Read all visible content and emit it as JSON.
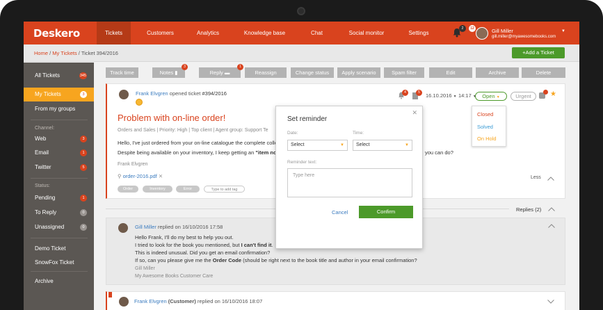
{
  "app": {
    "logo": "Deskero"
  },
  "nav": {
    "items": [
      "Tickets",
      "Customers",
      "Analytics",
      "Knowledge base",
      "Chat",
      "Social monitor",
      "Settings"
    ],
    "bell_count": "2",
    "user_badge": "12",
    "user_name": "Gill Miller",
    "user_email": "gill.miller@myawesomebooks.com"
  },
  "breadcrumb": {
    "home": "Home",
    "sep1": " / ",
    "my_tickets": "My Tickets",
    "current": " / Ticket 394/2016"
  },
  "add_ticket_label": "+Add a Ticket",
  "sidebar": {
    "all_tickets": {
      "label": "All Tickets",
      "count": "345"
    },
    "my_tickets": {
      "label": "My Tickets",
      "count": "3"
    },
    "from_groups": {
      "label": "From my groups"
    },
    "channel_head": "Channel:",
    "web": {
      "label": "Web",
      "count": "3"
    },
    "email": {
      "label": "Email",
      "count": "1"
    },
    "twitter": {
      "label": "Twitter",
      "count": "5"
    },
    "status_head": "Status:",
    "pending": {
      "label": "Pending",
      "count": "1"
    },
    "to_reply": {
      "label": "To Reply",
      "count": "0"
    },
    "unassigned": {
      "label": "Unassigned",
      "count": "0"
    },
    "demo_ticket": {
      "label": "Demo Ticket"
    },
    "snowfox": {
      "label": "SnowFox Ticket"
    },
    "archive": {
      "label": "Archive"
    }
  },
  "toolbar": {
    "track_time": "Track time",
    "notes": "Notes",
    "notes_count": "3",
    "reply": "Reply",
    "reply_count": "1",
    "reassign": "Reassign",
    "change_status": "Change status",
    "apply_scenario": "Apply scenario",
    "spam_filter": "Spam filter",
    "edit": "Edit",
    "archive": "Archive",
    "delete": "Delete"
  },
  "ticket": {
    "opener_name": "Frank Elvgren",
    "opener_text": " opened ticket ",
    "number": "#394/2016",
    "comment_count": "4",
    "notes_count": "5",
    "date": "16.10.2016",
    "time": "14:17",
    "status": "Open",
    "priority_pill": "Urgent",
    "title": "Problem with on-line order!",
    "meta": "Orders and Sales  |  Priority: High  |  Top client  |  Agent group: Support Te",
    "body_line1": "Hello, I've just ordered from your on-line catalogue the complete colle",
    "body_line2_a": "Despite being available on your inventory, I keep getting an ",
    "body_line2_b": "\"item not",
    "body_line2_tail": "you can do?",
    "signature": "Frank Elvgren",
    "attachment": "order-2016.pdf",
    "tags": [
      "Order",
      "Inventory",
      "Error"
    ],
    "add_tag": "Type to add tag",
    "less": "Less"
  },
  "status_menu": {
    "closed": "Closed",
    "solved": "Solved",
    "on_hold": "On Hold"
  },
  "reminder": {
    "title": "Set reminder",
    "date_label": "Date:",
    "time_label": "Time:",
    "date_value": "Select",
    "time_value": "Select",
    "text_label": "Reminder text:",
    "text_placeholder": "Type here",
    "cancel": "Cancel",
    "confirm": "Confirm"
  },
  "replies": {
    "label": "Replies (2)",
    "reply1": {
      "author": "Gill Miller",
      "meta": " replied on 16/10/2016 17:58",
      "line1": "Hello Frank, I'll do my best to help you out.",
      "line2_a": "I tried to look for the book you mentioned, but ",
      "line2_b": "I can't find it",
      "line2_c": ".",
      "line3": "This is indeed unusual. Did you get an email confirmation?",
      "line4_a": "If so, can you please give me the ",
      "line4_b": "Order Code",
      "line4_c": " (should be right next to the book title and author in your email confirmation?",
      "sig1": "Gill Miller",
      "sig2": "My Awesome Books Customer Care"
    },
    "reply2": {
      "author": "Frank Elvgren",
      "role": " (Customer)",
      "meta": " replied on 16/10/2016 18:07"
    }
  },
  "colors": {
    "brand": "#d9431e",
    "accent": "#f7a51f",
    "green": "#4c9a2a"
  }
}
